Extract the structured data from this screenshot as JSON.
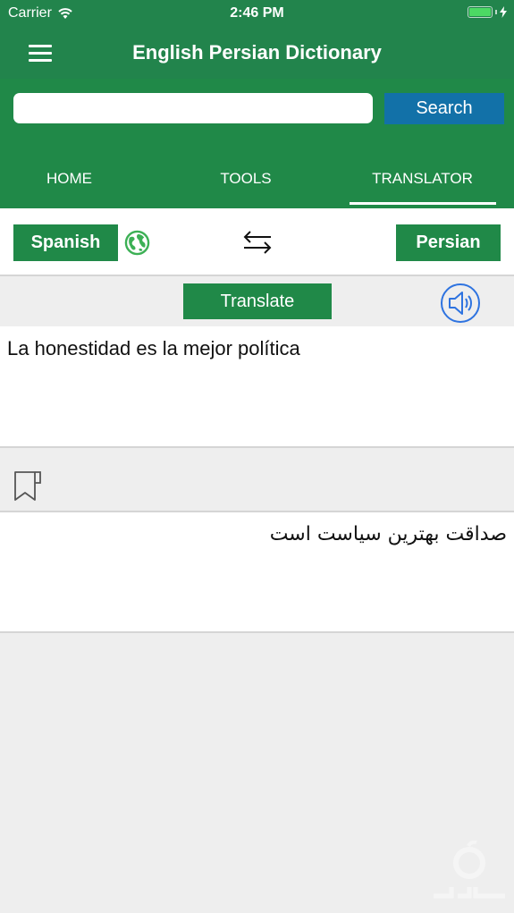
{
  "status_bar": {
    "carrier": "Carrier",
    "time": "2:46 PM",
    "battery_level": 1.0,
    "charging": true
  },
  "header": {
    "title": "English Persian Dictionary",
    "menu_icon": "hamburger-menu-icon"
  },
  "search": {
    "value": "",
    "placeholder": "",
    "button_label": "Search"
  },
  "tabs": [
    {
      "label": "HOME",
      "active": false
    },
    {
      "label": "TOOLS",
      "active": false
    },
    {
      "label": "TRANSLATOR",
      "active": true
    }
  ],
  "translator": {
    "source_language": "Spanish",
    "target_language": "Persian",
    "translate_label": "Translate",
    "source_text": "La honestidad es la mejor política",
    "translated_text": "صداقت بهترین سیاست است",
    "icons": {
      "globe": "globe-icon",
      "swap": "swap-arrows-icon",
      "speaker": "speaker-icon",
      "bookmark": "bookmark-icon"
    }
  },
  "colors": {
    "primary_green": "#208948",
    "header_green": "#22844c",
    "search_blue": "#1271a8",
    "speaker_blue": "#2e73e0",
    "background": "#eeeeee"
  }
}
